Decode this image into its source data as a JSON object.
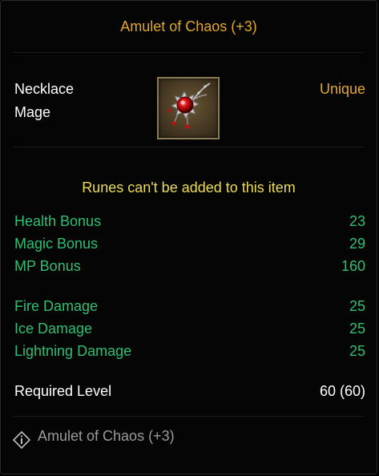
{
  "item": {
    "name": "Amulet of Chaos (+3)",
    "slot_type": "Necklace",
    "class": "Mage",
    "rarity": "Unique",
    "icon": "red-gem-amulet-icon",
    "rarity_color": "#e4a72a"
  },
  "runes_note": "Runes can't be added to this item",
  "bonus_stats": [
    {
      "label": "Health Bonus",
      "value": "23"
    },
    {
      "label": "Magic Bonus",
      "value": "29"
    },
    {
      "label": "MP Bonus",
      "value": "160"
    }
  ],
  "damage_stats": [
    {
      "label": "Fire Damage",
      "value": "25"
    },
    {
      "label": "Ice Damage",
      "value": "25"
    },
    {
      "label": "Lightning Damage",
      "value": "25"
    }
  ],
  "requirement": {
    "label": "Required Level",
    "value": "60 (60)"
  },
  "footer": {
    "icon": "info-diamond-icon",
    "text": "Amulet of Chaos (+3)"
  },
  "colors": {
    "stat_green": "#2fbf73",
    "note_yellow": "#eddc58",
    "footer_gray": "#9a9a9a"
  }
}
